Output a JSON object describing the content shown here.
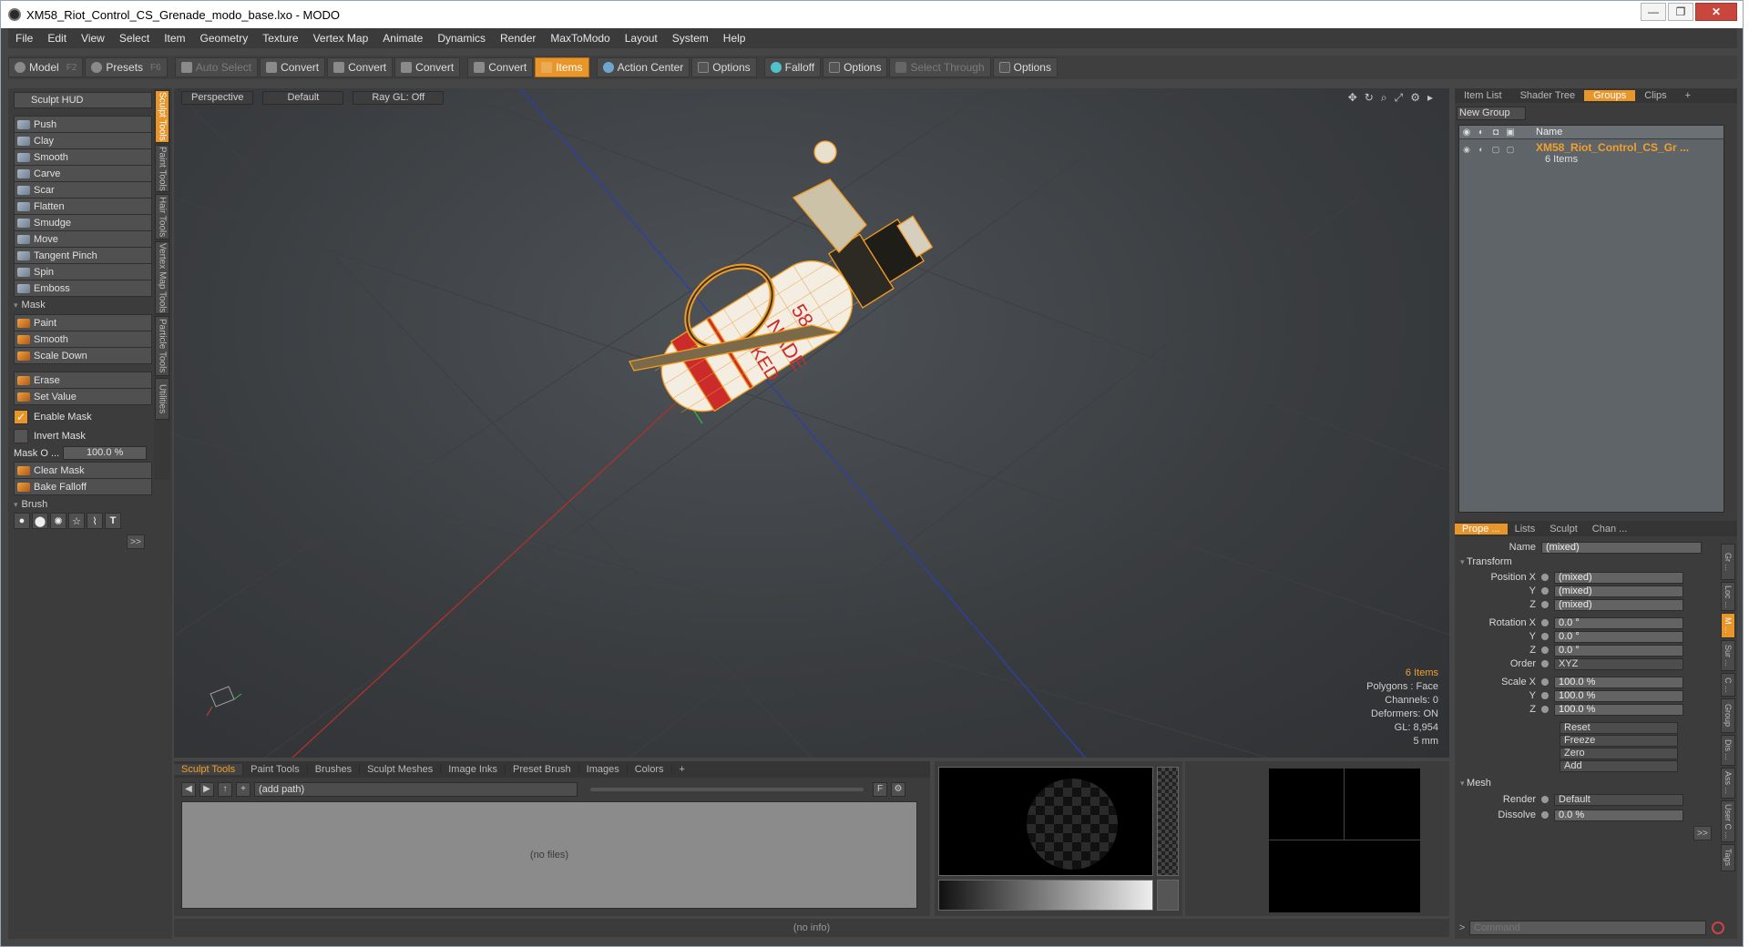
{
  "window": {
    "title": "XM58_Riot_Control_CS_Grenade_modo_base.lxo - MODO"
  },
  "menu": [
    "File",
    "Edit",
    "View",
    "Select",
    "Item",
    "Geometry",
    "Texture",
    "Vertex Map",
    "Animate",
    "Dynamics",
    "Render",
    "MaxToModo",
    "Layout",
    "System",
    "Help"
  ],
  "toolbar": {
    "model": "Model",
    "model_key": "F2",
    "presets": "Presets",
    "presets_key": "F6",
    "auto_select": "Auto Select",
    "convert1": "Convert",
    "convert2": "Convert",
    "convert3": "Convert",
    "convert4": "Convert",
    "items": "Items",
    "action_center": "Action Center",
    "options1": "Options",
    "falloff": "Falloff",
    "options2": "Options",
    "select_through": "Select Through",
    "options3": "Options"
  },
  "sculpt": {
    "hud": "Sculpt HUD",
    "tools": [
      "Push",
      "Clay",
      "Smooth",
      "Carve",
      "Scar",
      "Flatten",
      "Smudge",
      "Move",
      "Tangent Pinch",
      "Spin",
      "Emboss"
    ],
    "mask_section": "Mask",
    "mask_tools": [
      "Paint",
      "Smooth",
      "Scale Down"
    ],
    "erase": "Erase",
    "set_value": "Set Value",
    "enable_mask": "Enable Mask",
    "invert_mask": "Invert Mask",
    "mask_opacity_label": "Mask O ...",
    "mask_opacity_value": "100.0 %",
    "clear_mask": "Clear Mask",
    "bake_falloff": "Bake Falloff",
    "brush_section": "Brush",
    "more": ">>"
  },
  "left_vtabs": [
    "Sculpt Tools",
    "Paint Tools",
    "Hair Tools",
    "Vertex Map Tools",
    "Particle Tools",
    "Utilities"
  ],
  "viewport": {
    "perspective": "Perspective",
    "default": "Default",
    "raygl": "Ray GL: Off",
    "stats": {
      "items": "6 Items",
      "polygons": "Polygons : Face",
      "channels": "Channels: 0",
      "deformers": "Deformers: ON",
      "gl": "GL: 8,954",
      "unit": "5 mm"
    },
    "label_text_1": "58",
    "label_text_2": "NADE",
    "label_text_3": "CKED"
  },
  "browser": {
    "tabs": [
      "Sculpt Tools",
      "Paint Tools",
      "Brushes",
      "Sculpt Meshes",
      "Image Inks",
      "Preset Brush",
      "Images",
      "Colors",
      "+"
    ],
    "path": "(add path)",
    "empty": "(no files)"
  },
  "status": "(no info)",
  "right": {
    "tabs": [
      "Item List",
      "Shader Tree",
      "Groups",
      "Clips",
      "+"
    ],
    "new_group": "New Group",
    "col_name": "Name",
    "group_name": "XM58_Riot_Control_CS_Gr ...",
    "group_count": "6 Items",
    "props_tabs": [
      "Prope ...",
      "Lists",
      "Sculpt",
      "Chan ..."
    ],
    "name_label": "Name",
    "name_value": "(mixed)",
    "transform": "Transform",
    "position_x": "Position X",
    "y": "Y",
    "z": "Z",
    "pos_x": "(mixed)",
    "pos_y": "(mixed)",
    "pos_z": "(mixed)",
    "rotation_x": "Rotation X",
    "rot_x": "0.0 °",
    "rot_y": "0.0 °",
    "rot_z": "0.0 °",
    "order_label": "Order",
    "order_value": "XYZ",
    "scale_x": "Scale X",
    "sc_x": "100.0 %",
    "sc_y": "100.0 %",
    "sc_z": "100.0 %",
    "reset": "Reset",
    "freeze": "Freeze",
    "zero": "Zero",
    "add": "Add",
    "mesh": "Mesh",
    "render_label": "Render",
    "render_value": "Default",
    "dissolve_label": "Dissolve",
    "dissolve_value": "0.0 %",
    "more": ">>",
    "command_prefix": ">",
    "command_placeholder": "Command",
    "vtabs": [
      "Gr ...",
      "Loc ...",
      "M ...",
      "Sur ...",
      "C ...",
      "Group",
      "Dis ...",
      "Ass ...",
      "User C ...",
      "Tags"
    ]
  },
  "colors": {
    "accent": "#e8952a",
    "selection_text": "#f0a030",
    "mesh_wire": "#f29b22",
    "label_red": "#cc2b2b"
  }
}
